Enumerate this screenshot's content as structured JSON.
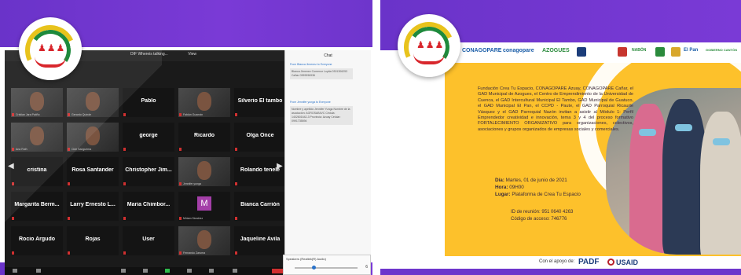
{
  "left_slide": {
    "zoom": {
      "speaking_label": "DIF Whereis talking...",
      "view_label": "View",
      "chat_title": "Chat",
      "chat_messages": [
        {
          "from": "From Blanca Jimenez to Everyone",
          "text": "Blanca Jimenez Comenor Lupita 0301306253 Cañar 0999996936"
        },
        {
          "from": "From Jennifer yunga to Everyone",
          "text": "Nombre y apellido Jennifer Yunga Nombre de la asociación: AGROSAB4VC Cédula: 1402601642-3 Provincia: Azuay Celular: 0991735894"
        }
      ],
      "tiles": [
        {
          "name": "",
          "sub": "Cristian Jara Patiño",
          "photo": true
        },
        {
          "name": "",
          "sub": "Gerardo Quinde",
          "photo": true
        },
        {
          "name": "Pablo",
          "sub": ""
        },
        {
          "name": "",
          "sub": "Fabián Guamán",
          "photo": true
        },
        {
          "name": "Silverio El tambo",
          "sub": ""
        },
        {
          "name": "",
          "sub": "Ana Ruth",
          "photo": true
        },
        {
          "name": "",
          "sub": "Cide Sangurima",
          "photo": true
        },
        {
          "name": "george",
          "sub": ""
        },
        {
          "name": "Ricardo",
          "sub": ""
        },
        {
          "name": "Olga Once",
          "sub": ""
        },
        {
          "name": "cristina",
          "sub": ""
        },
        {
          "name": "Rosa Santander",
          "sub": ""
        },
        {
          "name": "Christopher Jim...",
          "sub": ""
        },
        {
          "name": "",
          "sub": "Jennifer yunga",
          "photo": true
        },
        {
          "name": "Rolando tenele",
          "sub": ""
        },
        {
          "name": "Margarita Berm...",
          "sub": ""
        },
        {
          "name": "Larry Ernesto L...",
          "sub": ""
        },
        {
          "name": "Maria Chimbor...",
          "sub": ""
        },
        {
          "name": "",
          "sub": "Miriam Sánchez",
          "letter": "M"
        },
        {
          "name": "Bianca Carrión",
          "sub": ""
        },
        {
          "name": "Rocio Argudo",
          "sub": ""
        },
        {
          "name": "Rojas",
          "sub": ""
        },
        {
          "name": "User",
          "sub": ""
        },
        {
          "name": "",
          "sub": "Fernando Zaruma",
          "photo": true
        },
        {
          "name": "Jaqueline Avila",
          "sub": ""
        }
      ],
      "speaker_label": "Speakers (Realtek(R) Audio)",
      "speaker_value": "6"
    }
  },
  "right_slide": {
    "sponsors": [
      "CONAGOPARE",
      "conagopare",
      "AZOGUES",
      "NABÓN",
      "El Pan",
      "GOBIERNO CANTÓN"
    ],
    "description": "Fundación Crea Tu Espacio, CONAGOPARE Azuay, CONAGOPARE Cañar, el GAD Municipal de Azogues, el Centro de Emprendimiento de la Universidad de Cuenca, el GAD Intercultural Municipal El Tambo, GAD Municipal de Guatuco, el GAD Municipal El Pan, el CCPD - Paute, el GAD Parroquial Ricaurte Vásquez y el GAD Parroquial Nazón invitan a asistir al Módulo 1: Perfil Emprendedor creatividad e innovación, tema 3 y 4 del proceso formativo FORTALECIMIENTO ORGANIZATIVO para organizaciones, colectivos, asociaciones y grupos organizados de empresas sociales y comerciales.",
    "dia_label": "Día:",
    "dia_value": "Martes, 01 de junio de 2021",
    "hora_label": "Hora:",
    "hora_value": "09H00",
    "lugar_label": "Lugar:",
    "lugar_value": "Plataforma de Crea Tu Espacio",
    "meeting_id": "ID de reunión: 951 0640 4263",
    "access_code": "Código de acceso: 746776",
    "support_label": "Con el apoyo de:",
    "padf": "PADF",
    "usaid": "USAID"
  }
}
